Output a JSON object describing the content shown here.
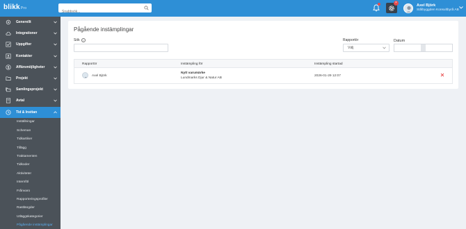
{
  "app": {
    "logo": "blikk",
    "logo_sub": "Pro"
  },
  "search": {
    "placeholder": "Snabbsök..."
  },
  "notifications": {
    "gear_badge": "×"
  },
  "user": {
    "name": "Axel Björk",
    "company": "Stålbyggden Konsultbyrå AB"
  },
  "sidebar": {
    "items": [
      {
        "label": "Generellt",
        "icon": "settings-sliders-icon"
      },
      {
        "label": "Integrationer",
        "icon": "cloud-icon"
      },
      {
        "label": "Uppgifter",
        "icon": "checkbox-icon"
      },
      {
        "label": "Kontakter",
        "icon": "contact-card-icon"
      },
      {
        "label": "Affärsmöjligheter",
        "icon": "dollar-icon"
      },
      {
        "label": "Projekt",
        "icon": "folder-icon"
      },
      {
        "label": "Samlingsprojekt",
        "icon": "folders-icon"
      },
      {
        "label": "Avtal",
        "icon": "contract-icon"
      },
      {
        "label": "Tid & Insttan",
        "icon": "clock-icon"
      }
    ],
    "sub_items": [
      "Inställningar",
      "Scheman",
      "Tidkartiker",
      "Tillägg",
      "Traktamenten",
      "Tidkoder",
      "Aktiviteter",
      "Internföl",
      "Frånvaro",
      "Rapporteringsprofiler",
      "Rastlängder",
      "Utläggskategorier",
      "Pågående instämplingar"
    ]
  },
  "page": {
    "title": "Pågående instämplingar",
    "filters": {
      "search_label": "Sök",
      "reporter_label": "Rapportör",
      "reporter_value": "Välj",
      "date_label": "Datum"
    },
    "table": {
      "columns": [
        "Rapportör",
        "Instämpling för",
        "Instämpling startad"
      ],
      "rows": [
        {
          "reporter": "Axel Björk",
          "for_title": "Nytt varumärke",
          "for_sub": "Lundmarks Djur & Natur AB",
          "started": "2026-01-29 12:07"
        }
      ]
    }
  },
  "colors": {
    "primary": "#2e8fd6",
    "sidebar": "#4b5259",
    "danger": "#e84a4a"
  }
}
